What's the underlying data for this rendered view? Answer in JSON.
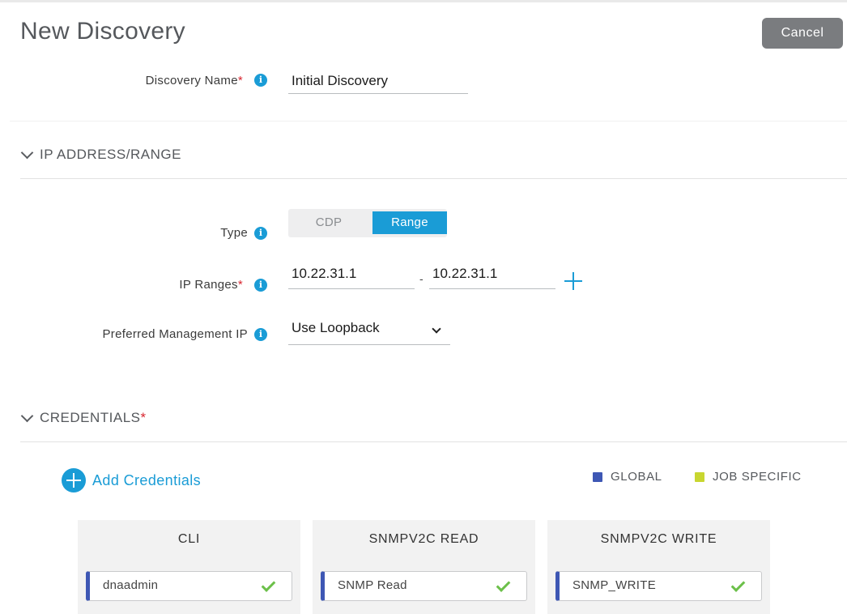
{
  "header": {
    "title": "New Discovery",
    "cancel_label": "Cancel"
  },
  "discovery_name": {
    "label": "Discovery Name",
    "required_mark": "*",
    "value": "Initial Discovery"
  },
  "ip_section": {
    "title": "IP ADDRESS/RANGE",
    "type_label": "Type",
    "type_options": [
      "CDP",
      "Range"
    ],
    "type_selected": "Range",
    "ip_ranges_label": "IP Ranges",
    "required_mark": "*",
    "range_start": "10.22.31.1",
    "range_separator": "-",
    "range_end": "10.22.31.1",
    "pref_mgmt_label": "Preferred Management IP",
    "pref_mgmt_value": "Use Loopback"
  },
  "credentials": {
    "title": "CREDENTIALS",
    "required_mark": "*",
    "add_label": "Add Credentials",
    "legend": [
      {
        "label": "GLOBAL",
        "color": "#3e57b4"
      },
      {
        "label": "JOB SPECIFIC",
        "color": "#c8d630"
      }
    ],
    "cards": [
      {
        "title": "CLI",
        "item": "dnaadmin"
      },
      {
        "title": "SNMPV2C READ",
        "item": "SNMP Read"
      },
      {
        "title": "SNMPV2C WRITE",
        "item": "SNMP_WRITE"
      }
    ]
  },
  "colors": {
    "accent": "#1a9cd6",
    "required": "#d8252f",
    "global": "#3e57b4",
    "job_specific": "#c8d630",
    "success": "#6cc04a"
  }
}
